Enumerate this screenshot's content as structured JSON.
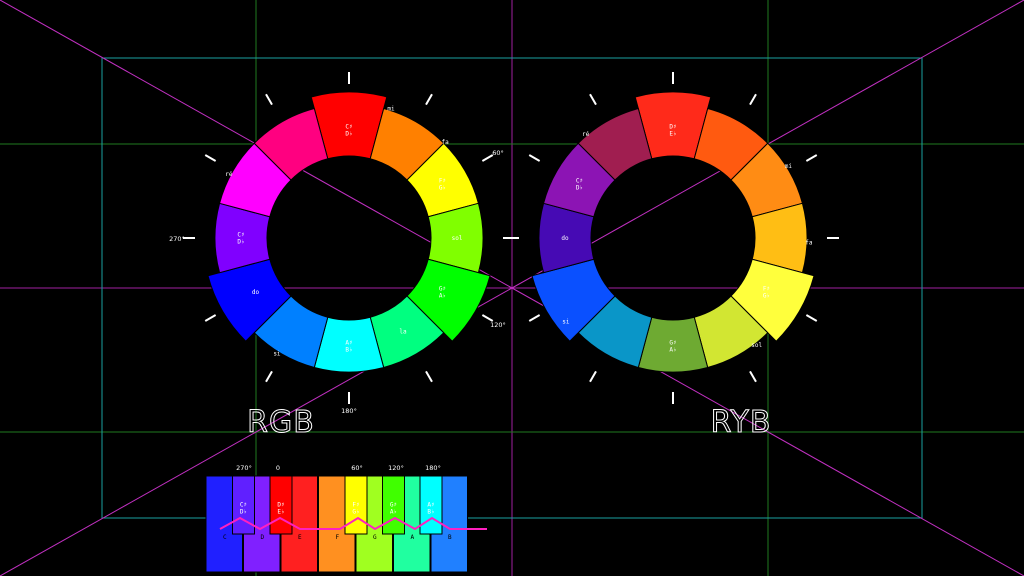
{
  "wheels": [
    {
      "id": "rgb",
      "title": "RGB",
      "segments": [
        {
          "color": "#ff0000",
          "label": "C♯/D♭",
          "note": "",
          "extended": true
        },
        {
          "color": "#ff8000",
          "label": "",
          "note": ""
        },
        {
          "color": "#ffff00",
          "label": "F♯/G♭",
          "note": ""
        },
        {
          "color": "#80ff00",
          "label": "sol",
          "note": ""
        },
        {
          "color": "#00ff00",
          "label": "G♯/A♭",
          "note": "",
          "extended": true
        },
        {
          "color": "#00ff80",
          "label": "la",
          "note": ""
        },
        {
          "color": "#00ffff",
          "label": "A♯/B♭",
          "note": ""
        },
        {
          "color": "#0080ff",
          "label": "",
          "note": ""
        },
        {
          "color": "#0000ff",
          "label": "do",
          "note": "",
          "extended": true
        },
        {
          "color": "#8000ff",
          "label": "C♯/D♭",
          "note": ""
        },
        {
          "color": "#ff00ff",
          "label": "",
          "note": ""
        },
        {
          "color": "#ff0080",
          "label": "",
          "note": ""
        }
      ],
      "outer_labels": [
        {
          "text": "mi",
          "angle": 18
        },
        {
          "text": "fa",
          "angle": 45
        },
        {
          "text": "ré",
          "angle": 298
        },
        {
          "text": "si",
          "angle": 212
        }
      ],
      "degree_labels": [
        {
          "text": "60°",
          "angle": 60
        },
        {
          "text": "120°",
          "angle": 120
        },
        {
          "text": "180°",
          "angle": 180
        },
        {
          "text": "270°",
          "angle": 270
        }
      ]
    },
    {
      "id": "ryb",
      "title": "RYB",
      "segments": [
        {
          "color": "#ff2a1a",
          "label": "D♯/E♭",
          "note": "",
          "extended": true
        },
        {
          "color": "#ff5a10",
          "label": "",
          "note": ""
        },
        {
          "color": "#ff8c14",
          "label": "",
          "note": ""
        },
        {
          "color": "#ffbe14",
          "label": "",
          "note": ""
        },
        {
          "color": "#ffff3c",
          "label": "F♯/G♭",
          "note": "",
          "extended": true
        },
        {
          "color": "#d2e632",
          "label": "",
          "note": ""
        },
        {
          "color": "#6eaa32",
          "label": "G♯/A♭",
          "note": ""
        },
        {
          "color": "#0a96c8",
          "label": "",
          "note": ""
        },
        {
          "color": "#0a50ff",
          "label": "",
          "note": "",
          "extended": true
        },
        {
          "color": "#460ab4",
          "label": "do",
          "note": ""
        },
        {
          "color": "#8c14b4",
          "label": "C♯/D♭",
          "note": ""
        },
        {
          "color": "#a01e50",
          "label": "",
          "note": ""
        }
      ],
      "outer_labels": [
        {
          "text": "mi",
          "angle": 58
        },
        {
          "text": "fa",
          "angle": 92
        },
        {
          "text": "sol",
          "angle": 142
        },
        {
          "text": "si",
          "angle": 232
        },
        {
          "text": "ré",
          "angle": 320
        }
      ],
      "degree_labels": []
    }
  ],
  "keyboard": {
    "degree_labels": [
      "270°",
      "0",
      "60°",
      "120°",
      "180°"
    ],
    "white_keys": [
      {
        "color": "#2020ff",
        "note": "C"
      },
      {
        "color": "#8020ff",
        "note": "D"
      },
      {
        "color": "#ff2020",
        "note": "E"
      },
      {
        "color": "#ff9020",
        "note": "F"
      },
      {
        "color": "#a0ff20",
        "note": "G"
      },
      {
        "color": "#20ffa0",
        "note": "A"
      },
      {
        "color": "#2080ff",
        "note": "B"
      }
    ],
    "black_keys": [
      {
        "color": "#6020ff",
        "label": "C♯/D♭"
      },
      {
        "color": "#ff0000",
        "label": "D♯/E♭"
      },
      {
        "color": "#ffff00",
        "label": "F♯/G♭"
      },
      {
        "color": "#40ff00",
        "label": "G♯/A♭"
      },
      {
        "color": "#00ffff",
        "label": "A♯/B♭"
      }
    ],
    "line_color": "#ff20c0"
  },
  "grid_colors": {
    "green": "#1f7a1f",
    "magenta": "#a020a0",
    "cyan": "#1aa0a0"
  }
}
